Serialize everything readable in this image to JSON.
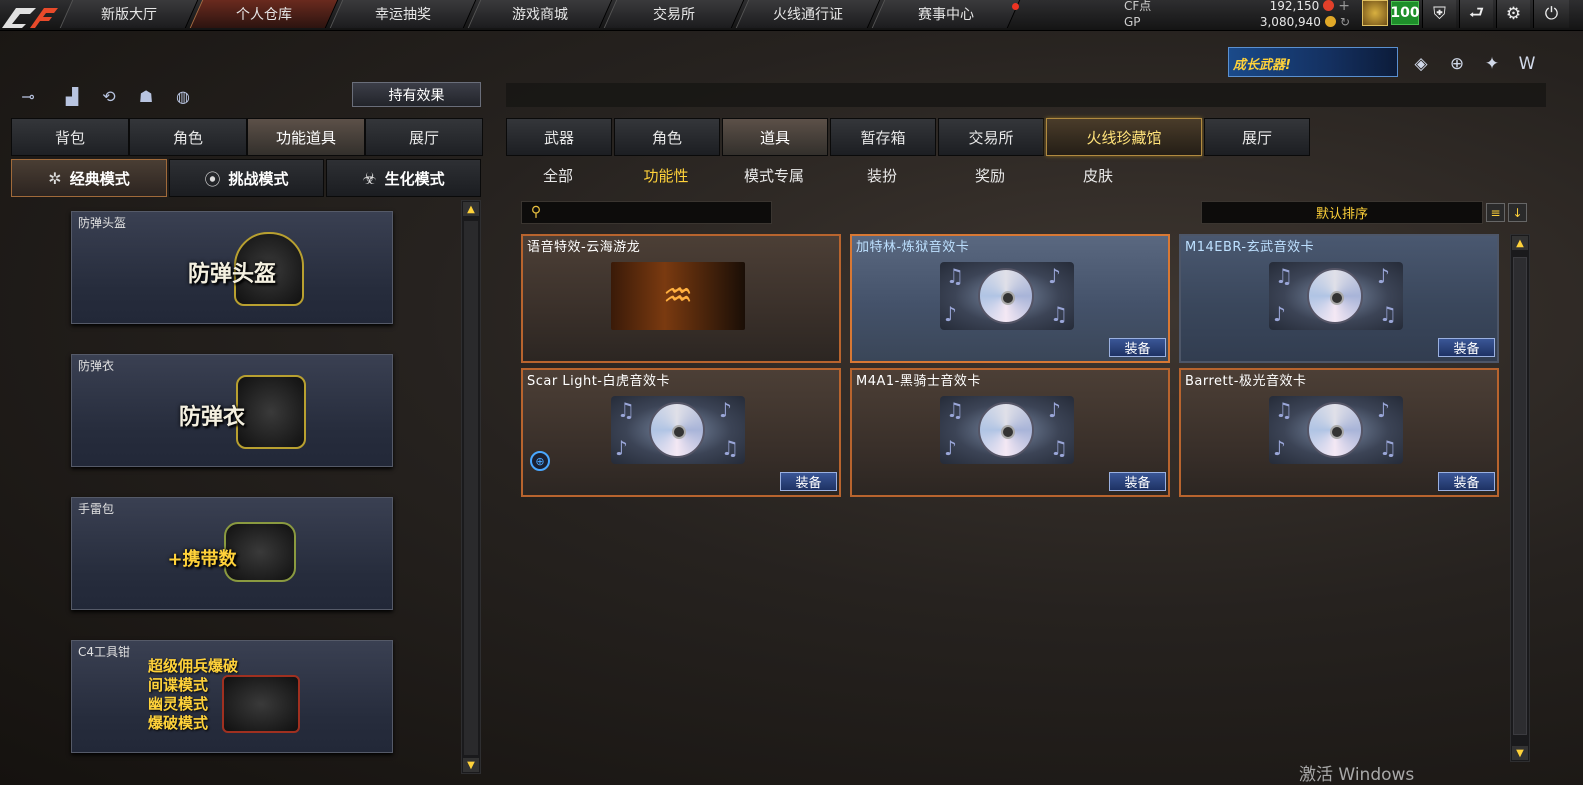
{
  "topnav": {
    "logo": "CF",
    "items": [
      "新版大厅",
      "个人仓库",
      "幸运抽奖",
      "游戏商城",
      "交易所",
      "火线通行证",
      "赛事中心"
    ],
    "active": "个人仓库"
  },
  "currency": {
    "cf_label": "CF点",
    "cf_value": "192,150",
    "gp_label": "GP",
    "gp_value": "3,080,940"
  },
  "player": {
    "level": "100"
  },
  "toolbar_icons": [
    "shield-badge-icon",
    "exit-arrow-icon",
    "gear-icon",
    "power-icon"
  ],
  "promo": {
    "text": "成长武器!"
  },
  "left": {
    "effect_button": "持有效果",
    "tabs": [
      "背包",
      "角色",
      "功能道具",
      "展厅"
    ],
    "active_tab": "功能道具",
    "modes": [
      "经典模式",
      "挑战模式",
      "生化模式"
    ],
    "active_mode": "经典模式",
    "cards": [
      {
        "caption": "防弹头盔",
        "art_text": "防弹头盔"
      },
      {
        "caption": "防弹衣",
        "art_text": "防弹衣"
      },
      {
        "caption": "手雷包",
        "art_text": "+携带数"
      },
      {
        "caption": "C4工具钳",
        "art_lines": [
          "超级佣兵爆破",
          "间谍模式",
          "幽灵模式",
          "爆破模式"
        ]
      }
    ]
  },
  "right": {
    "tabs": [
      "武器",
      "角色",
      "道具",
      "暂存箱",
      "交易所",
      "火线珍藏馆",
      "展厅"
    ],
    "active_tab": "道具",
    "subtabs": [
      "全部",
      "功能性",
      "模式专属",
      "装扮",
      "奖励",
      "皮肤"
    ],
    "active_subtab": "功能性",
    "search_placeholder": "",
    "sort_label": "默认排序",
    "items": [
      {
        "name": "语音特效-云海游龙",
        "equip": ""
      },
      {
        "name": "加特林-炼狱音效卡",
        "equip": "装备"
      },
      {
        "name": "M14EBR-玄武音效卡",
        "equip": "装备"
      },
      {
        "name": "Scar Light-白虎音效卡",
        "equip": "装备"
      },
      {
        "name": "M4A1-黑骑士音效卡",
        "equip": "装备"
      },
      {
        "name": "Barrett-极光音效卡",
        "equip": "装备"
      }
    ]
  },
  "watermark": "激活 Windows",
  "colors": {
    "accent_gold": "#ffd23a",
    "equip_blue": "#2a4584",
    "card_border_orange": "#b8642e",
    "level_green": "#1e8f2a"
  }
}
